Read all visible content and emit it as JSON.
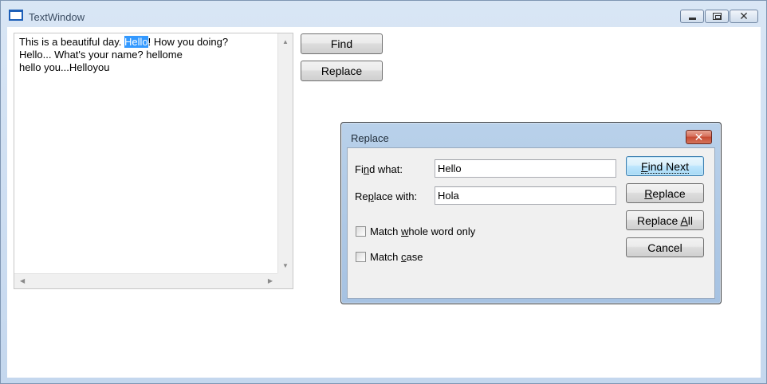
{
  "window": {
    "title": "TextWindow"
  },
  "editor": {
    "line1_before": "This is a beautiful day. ",
    "line1_selected": "Hello",
    "line1_after": "! How you doing?",
    "line2": "Hello... What's your name? hellome",
    "line3": "hello you...Helloyou"
  },
  "main_buttons": {
    "find": "Find",
    "replace": "Replace"
  },
  "dialog": {
    "title": "Replace",
    "find_what_label_pre": "Fi",
    "find_what_label_key": "n",
    "find_what_label_post": "d what:",
    "find_what_value": "Hello",
    "replace_with_label_pre": "Re",
    "replace_with_label_key": "p",
    "replace_with_label_post": "lace with:",
    "replace_with_value": "Hola",
    "match_whole_pre": "Match ",
    "match_whole_key": "w",
    "match_whole_post": "hole word only",
    "match_case_pre": "Match ",
    "match_case_key": "c",
    "match_case_post": "ase",
    "find_next_key": "F",
    "find_next_post": "ind Next",
    "replace_key": "R",
    "replace_post": "eplace",
    "replace_all_pre": "Replace ",
    "replace_all_key": "A",
    "replace_all_post": "ll",
    "cancel": "Cancel"
  },
  "colors": {
    "selection": "#3399ff",
    "titlebar": "#c4d7ee",
    "dialog_close": "#c74a32"
  },
  "icons": {
    "app": "window-icon",
    "minimize": "minimize-icon",
    "maximize": "restore-icon",
    "close": "close-icon"
  }
}
